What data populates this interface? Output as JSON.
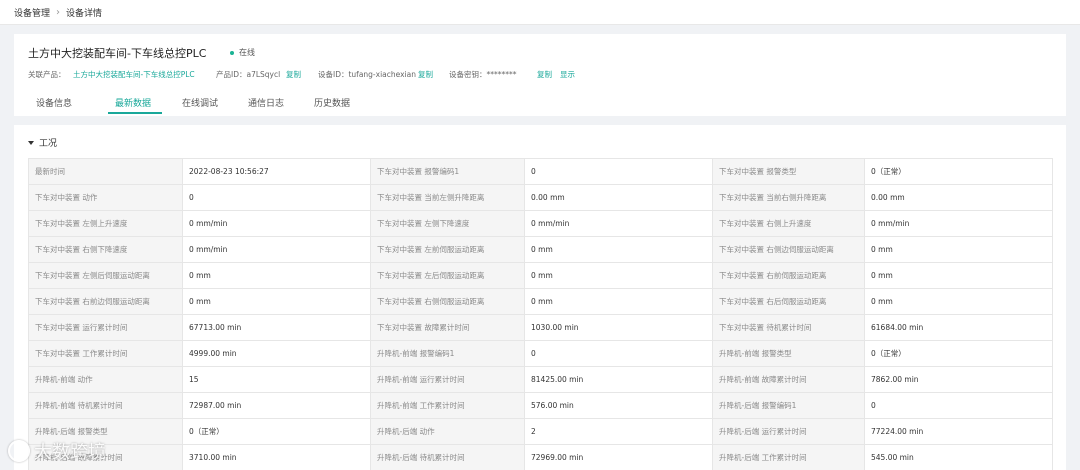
{
  "breadcrumb": {
    "root": "设备管理",
    "current": "设备详情"
  },
  "device": {
    "name": "土方中大挖装配车间-下车线总控PLC",
    "status": "在线",
    "product_label": "关联产品：",
    "product_value": "土方中大挖装配车间-下车线总控PLC",
    "product_id_label": "产品ID：a7LSqycl",
    "copy": "复制",
    "device_id_label": "设备ID：tufang-xiachexian",
    "secret_label": "设备密钥：********",
    "show": "显示"
  },
  "tabs": [
    "设备信息",
    "最新数据",
    "在线调试",
    "通信日志",
    "历史数据"
  ],
  "section": {
    "title": "工况"
  },
  "rows": [
    [
      "最新时间",
      "2022-08-23 10:56:27",
      "下车对中装置 报警编码1",
      "0",
      "下车对中装置 报警类型",
      "0（正常）"
    ],
    [
      "下车对中装置 动作",
      "0",
      "下车对中装置 当前左侧升降距离",
      "0.00 mm",
      "下车对中装置 当前右侧升降距离",
      "0.00 mm"
    ],
    [
      "下车对中装置 左侧上升速度",
      "0 mm/min",
      "下车对中装置 左侧下降速度",
      "0 mm/min",
      "下车对中装置 右侧上升速度",
      "0 mm/min"
    ],
    [
      "下车对中装置 右侧下降速度",
      "0 mm/min",
      "下车对中装置 左前伺服运动距离",
      "0 mm",
      "下车对中装置 右侧边伺服运动距离",
      "0 mm"
    ],
    [
      "下车对中装置 左侧后伺服运动距离",
      "0 mm",
      "下车对中装置 左后伺服运动距离",
      "0 mm",
      "下车对中装置 右前伺服运动距离",
      "0 mm"
    ],
    [
      "下车对中装置 右前边伺服运动距离",
      "0 mm",
      "下车对中装置 右侧伺服运动距离",
      "0 mm",
      "下车对中装置 右后伺服运动距离",
      "0 mm"
    ],
    [
      "下车对中装置 运行累计时间",
      "67713.00 min",
      "下车对中装置 故障累计时间",
      "1030.00 min",
      "下车对中装置 待机累计时间",
      "61684.00 min"
    ],
    [
      "下车对中装置 工作累计时间",
      "4999.00 min",
      "升降机-前端 报警编码1",
      "0",
      "升降机-前端 报警类型",
      "0（正常）"
    ],
    [
      "升降机-前端 动作",
      "15",
      "升降机-前端 运行累计时间",
      "81425.00 min",
      "升降机-前端 故障累计时间",
      "7862.00 min"
    ],
    [
      "升降机-前端 待机累计时间",
      "72987.00 min",
      "升降机-前端 工作累计时间",
      "576.00 min",
      "升降机-后端 报警编码1",
      "0"
    ],
    [
      "升降机-后端 报警类型",
      "0（正常）",
      "升降机-后端 动作",
      "2",
      "升降机-后端 运行累计时间",
      "77224.00 min"
    ],
    [
      "升降机-后端 故障累计时间",
      "3710.00 min",
      "升降机-后端 待机累计时间",
      "72969.00 min",
      "升降机-后端 工作累计时间",
      "545.00 min"
    ]
  ],
  "watermark": "大数跨境",
  "colors": {
    "accent": "#19a89a",
    "online_dot": "#1ab394",
    "key_cell_bg": "#f5f5f5"
  }
}
